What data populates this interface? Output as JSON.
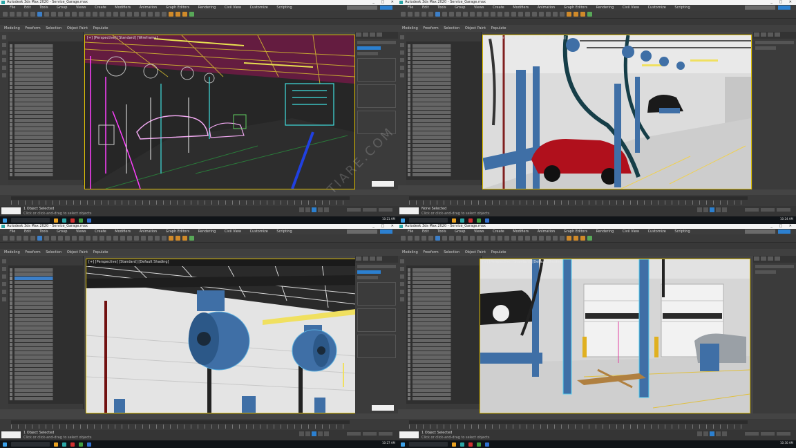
{
  "screens": [
    {
      "id": "tl",
      "window_title": "Autodesk 3ds Max 2020 - Service_Garage.max",
      "menu": [
        "File",
        "Edit",
        "Tools",
        "Group",
        "Views",
        "Create",
        "Modifiers",
        "Animation",
        "Graph Editors",
        "Rendering",
        "Civil View",
        "Customize",
        "Scripting",
        "Interactive",
        "Content",
        "Arnold",
        "Help"
      ],
      "ribbon": [
        "Modeling",
        "Freeform",
        "Selection",
        "Object Paint",
        "Populate"
      ],
      "viewport_label": "[+] [Perspective] [Standard] [Wireframe]",
      "status": "1 Object Selected",
      "hint": "Click or click-and-drag to select objects",
      "maxscript": "MAXScript Mi",
      "clock": "10:21 AM",
      "render_mode": "wireframe"
    },
    {
      "id": "tr",
      "window_title": "Autodesk 3ds Max 2020 - Service_Garage.max",
      "menu": [
        "File",
        "Edit",
        "Tools",
        "Group",
        "Views",
        "Create",
        "Modifiers",
        "Animation",
        "Graph Editors",
        "Rendering",
        "Civil View",
        "Customize",
        "Scripting",
        "Interactive",
        "Content",
        "Arnold",
        "Help"
      ],
      "ribbon": [
        "Modeling",
        "Freeform",
        "Selection",
        "Object Paint",
        "Populate"
      ],
      "viewport_label": "[+] [Camera001] [Standard] [Default Shading]",
      "status": "None Selected",
      "hint": "Click or click-and-drag to select objects",
      "maxscript": "MAXScript Mi",
      "clock": "10:24 AM",
      "render_mode": "shaded"
    },
    {
      "id": "bl",
      "window_title": "Autodesk 3ds Max 2020 - Service_Garage.max",
      "menu": [
        "File",
        "Edit",
        "Tools",
        "Group",
        "Views",
        "Create",
        "Modifiers",
        "Animation",
        "Graph Editors",
        "Rendering",
        "Civil View",
        "Customize",
        "Scripting",
        "Interactive",
        "Content",
        "Arnold",
        "Help"
      ],
      "ribbon": [
        "Modeling",
        "Freeform",
        "Selection",
        "Object Paint",
        "Populate"
      ],
      "viewport_label": "[+] [Perspective] [Standard] [Default Shading]",
      "status": "1 Object Selected",
      "hint": "Click or click-and-drag to select objects",
      "maxscript": "MAXScript Mi",
      "clock": "10:27 AM",
      "render_mode": "shaded"
    },
    {
      "id": "br",
      "window_title": "Autodesk 3ds Max 2020 - Service_Garage.max",
      "menu": [
        "File",
        "Edit",
        "Tools",
        "Group",
        "Views",
        "Create",
        "Modifiers",
        "Animation",
        "Graph Editors",
        "Rendering",
        "Civil View",
        "Customize",
        "Scripting",
        "Interactive",
        "Content",
        "Arnold",
        "Help"
      ],
      "ribbon": [
        "Modeling",
        "Freeform",
        "Selection",
        "Object Paint",
        "Populate"
      ],
      "viewport_label": "[+] [Perspective] [Standard] [Default Shading]",
      "status": "1 Object Selected",
      "hint": "Click or click-and-drag to select objects",
      "maxscript": "MAXScript Mi",
      "clock": "10:30 AM",
      "render_mode": "shaded"
    }
  ],
  "watermark": "TIARE.COM",
  "colors": {
    "selection_blue": "#2c80d0",
    "active_viewport": "#e0c000",
    "ui_dark": "#3b3b3b",
    "lift_blue": "#3f6fa6",
    "car_red": "#b0101c"
  }
}
